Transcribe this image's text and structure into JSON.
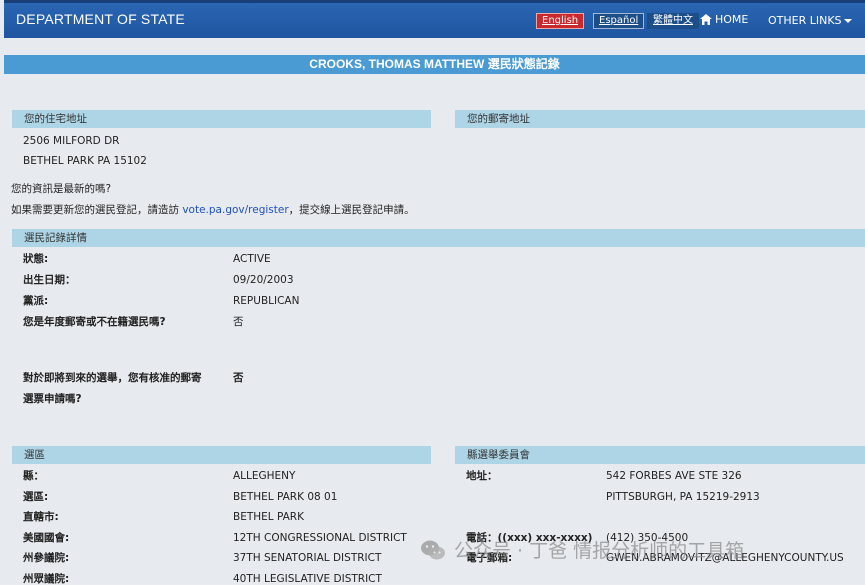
{
  "header": {
    "brand": "DEPARTMENT OF STATE",
    "lang_english": "English",
    "lang_spanish": "Español",
    "lang_chinese": "繁體中文",
    "home": "HOME",
    "other_links": "OTHER LINKS"
  },
  "page_title": "CROOKS, THOMAS MATTHEW 選民狀態記錄",
  "residential": {
    "heading": "您的住宅地址",
    "line1": "2506 MILFORD DR",
    "line2": "BETHEL PARK PA 15102"
  },
  "mailing": {
    "heading": "您的郵寄地址"
  },
  "update_notice": {
    "question": "您的資訊是最新的嗎?",
    "prefix": "如果需要更新您的選民登記，請造訪",
    "link": "vote.pa.gov/register",
    "suffix": "，提交線上選民登記申請。"
  },
  "voter_record": {
    "heading": "選民記錄詳情",
    "rows": [
      {
        "label": "狀態:",
        "value": "ACTIVE"
      },
      {
        "label": "出生日期：",
        "value": "09/20/2003"
      },
      {
        "label": "黨派:",
        "value": "REPUBLICAN"
      },
      {
        "label": "您是年度郵寄或不在籍選民嗎?",
        "value": "否"
      }
    ],
    "mail_ballot_label_1": "對於即將到來的選舉，您有核准的郵寄",
    "mail_ballot_label_2": "選票申請嗎?",
    "mail_ballot_value": "否"
  },
  "district": {
    "heading": "選區",
    "rows": [
      {
        "label": "縣：",
        "value": "ALLEGHENY"
      },
      {
        "label": "選區:",
        "value": "BETHEL PARK 08 01"
      },
      {
        "label": "直轄市:",
        "value": "BETHEL PARK"
      },
      {
        "label": "美國國會:",
        "value": "12TH CONGRESSIONAL DISTRICT"
      },
      {
        "label": "州參議院:",
        "value": "37TH SENATORIAL DISTRICT"
      },
      {
        "label": "州眾議院:",
        "value": "40TH LEGISLATIVE DISTRICT"
      }
    ]
  },
  "county_board": {
    "heading": "縣選舉委員會",
    "address_label": "地址：",
    "address_line1": "542 FORBES AVE STE 326",
    "address_line2": "PITTSBURGH, PA 15219-2913",
    "phone_label": "電話：((xxx) xxx-xxxx)",
    "phone_value": "(412) 350-4500",
    "email_label": "電子郵箱:",
    "email_value": "GWEN.ABRAMOVITZ@ALLEGHENYCOUNTY.US"
  },
  "watermark": "公众号 · 丁爸 情报分析师的工具箱"
}
